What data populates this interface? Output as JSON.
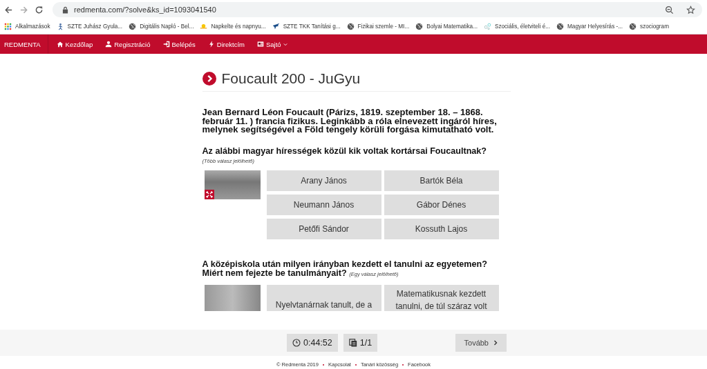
{
  "browser": {
    "url": "redmenta.com/?solve&ks_id=1093041540",
    "bookmarks": [
      {
        "label": "Alkalmazások"
      },
      {
        "label": "SZTE Juhász Gyula..."
      },
      {
        "label": "Digitális Napló - Bel..."
      },
      {
        "label": "Napkelte és napnyu..."
      },
      {
        "label": "SZTE TKK Tanítási g..."
      },
      {
        "label": "Fizikai szemle - MI..."
      },
      {
        "label": "Bolyai Matematika..."
      },
      {
        "label": "Szociális, életviteli é..."
      },
      {
        "label": "Magyar Helyesírás -..."
      },
      {
        "label": "szociogram"
      }
    ]
  },
  "navbar": {
    "brand": "REDMENTA",
    "items": [
      {
        "label": "Kezdőlap",
        "dropdown": false
      },
      {
        "label": "Regisztráció",
        "dropdown": false
      },
      {
        "label": "Belépés",
        "dropdown": false
      },
      {
        "label": "Direktcím",
        "dropdown": false
      },
      {
        "label": "Sajtó",
        "dropdown": true
      }
    ]
  },
  "page": {
    "title": "Foucault 200 - JuGyu",
    "intro": "Jean Bernard Léon Foucault (Párizs, 1819. szeptember 18. – 1868. február 11. ) francia fizikus. Leginkább a róla elnevezett ingáról híres, melynek segítségével a Föld tengely körüli forgása kimutatható volt.",
    "questions": [
      {
        "text": "Az alábbi magyar hírességek közül kik voltak kortársai Foucaultnak?",
        "hint": "(Több válasz jelölhető)",
        "zoom_button": true,
        "answers": [
          {
            "text": "Arany János"
          },
          {
            "text": "Bartók Béla"
          },
          {
            "text": "Neumann János"
          },
          {
            "text": "Gábor Dénes"
          },
          {
            "text": "Petőfi Sándor"
          },
          {
            "text": "Kossuth Lajos"
          }
        ]
      },
      {
        "text": "A középiskola után milyen irányban kezdett el tanulni az egyetemen? Miért nem fejezte be tanulmányait? *(Egy válasz jelölhető)*",
        "zoom_button": false,
        "answers": [
          {
            "text": "Nyelvtanárnak tanult, de a"
          },
          {
            "text": "Matematikusnak kezdett tanulni, de túl száraz volt"
          }
        ]
      }
    ]
  },
  "bottom_bar": {
    "timer": "0:44:52",
    "pages": "1/1",
    "next": "Tovább"
  },
  "footer": [
    "© Redmenta 2019",
    "Kapcsolat",
    "Tanári közösség",
    "Facebook"
  ]
}
